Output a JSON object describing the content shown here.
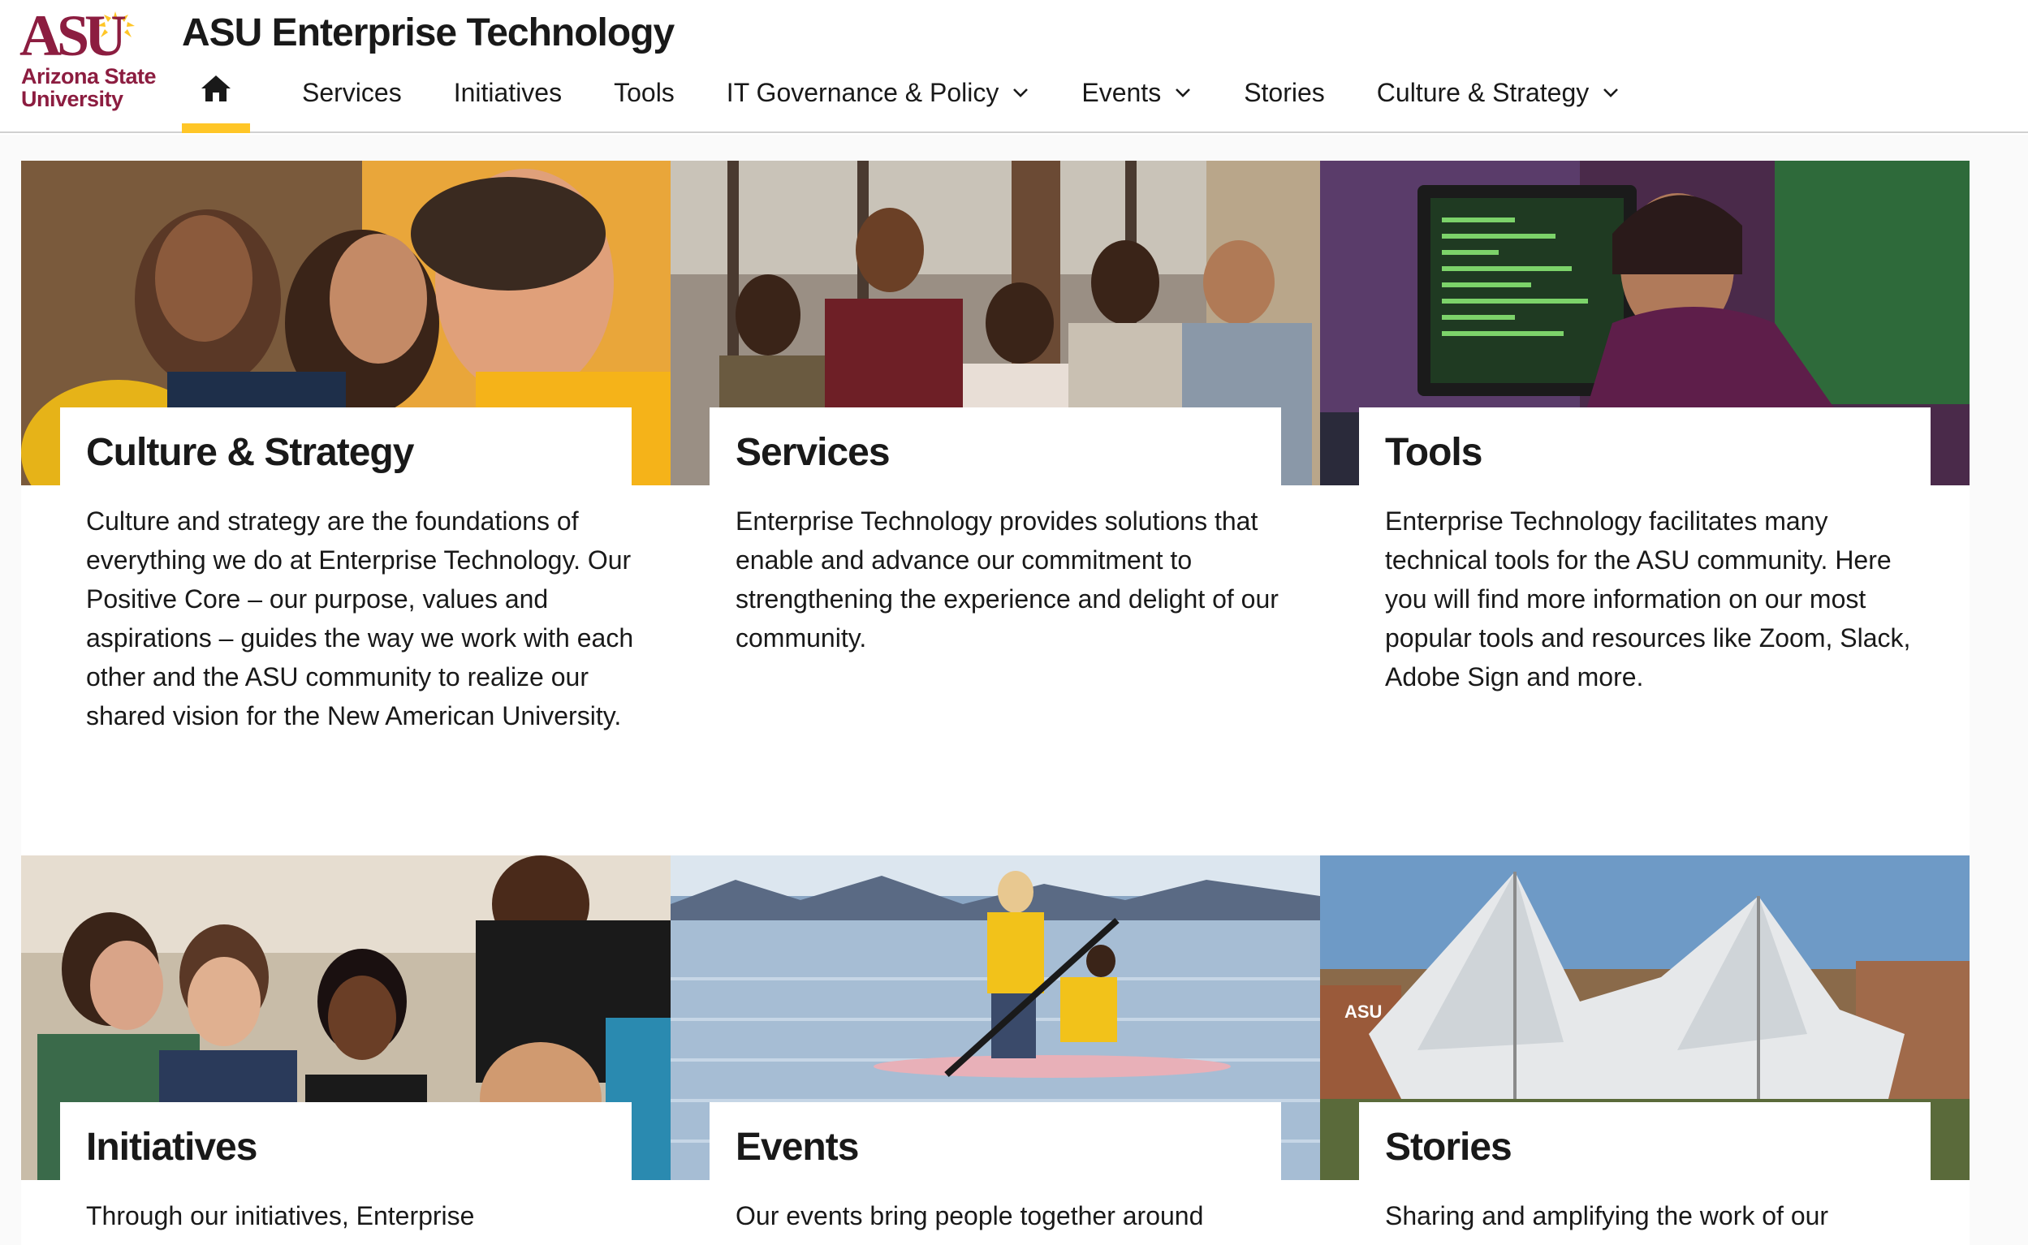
{
  "brand": {
    "logo_mark": "ASU",
    "logo_line1": "Arizona State",
    "logo_line2": "University",
    "maroon": "#8c1d40",
    "gold": "#ffc627"
  },
  "header": {
    "title": "ASU Enterprise Technology"
  },
  "nav": {
    "home_icon": "home-icon",
    "items": [
      {
        "label": "Services",
        "has_dropdown": false
      },
      {
        "label": "Initiatives",
        "has_dropdown": false
      },
      {
        "label": "Tools",
        "has_dropdown": false
      },
      {
        "label": "IT Governance & Policy",
        "has_dropdown": true
      },
      {
        "label": "Events",
        "has_dropdown": true
      },
      {
        "label": "Stories",
        "has_dropdown": false
      },
      {
        "label": "Culture & Strategy",
        "has_dropdown": true
      }
    ]
  },
  "cards": [
    {
      "title": "Culture & Strategy",
      "body": "Culture and strategy are the foundations of everything we do at Enterprise Technology. Our Positive Core – our purpose, values and aspirations – guides the way we work with each other and the ASU community to realize our shared vision for the New American University."
    },
    {
      "title": "Services",
      "body": "Enterprise Technology provides solutions that enable and advance our commitment to strengthening the experience and delight of our community."
    },
    {
      "title": "Tools",
      "body": "Enterprise Technology facilitates many technical tools for the ASU community. Here you will find more information on our most popular tools and resources like Zoom, Slack, Adobe Sign and more."
    },
    {
      "title": "Initiatives",
      "body": "Through our initiatives, Enterprise"
    },
    {
      "title": "Events",
      "body": "Our events bring people together around"
    },
    {
      "title": "Stories",
      "body": "Sharing and amplifying the work of our"
    }
  ]
}
